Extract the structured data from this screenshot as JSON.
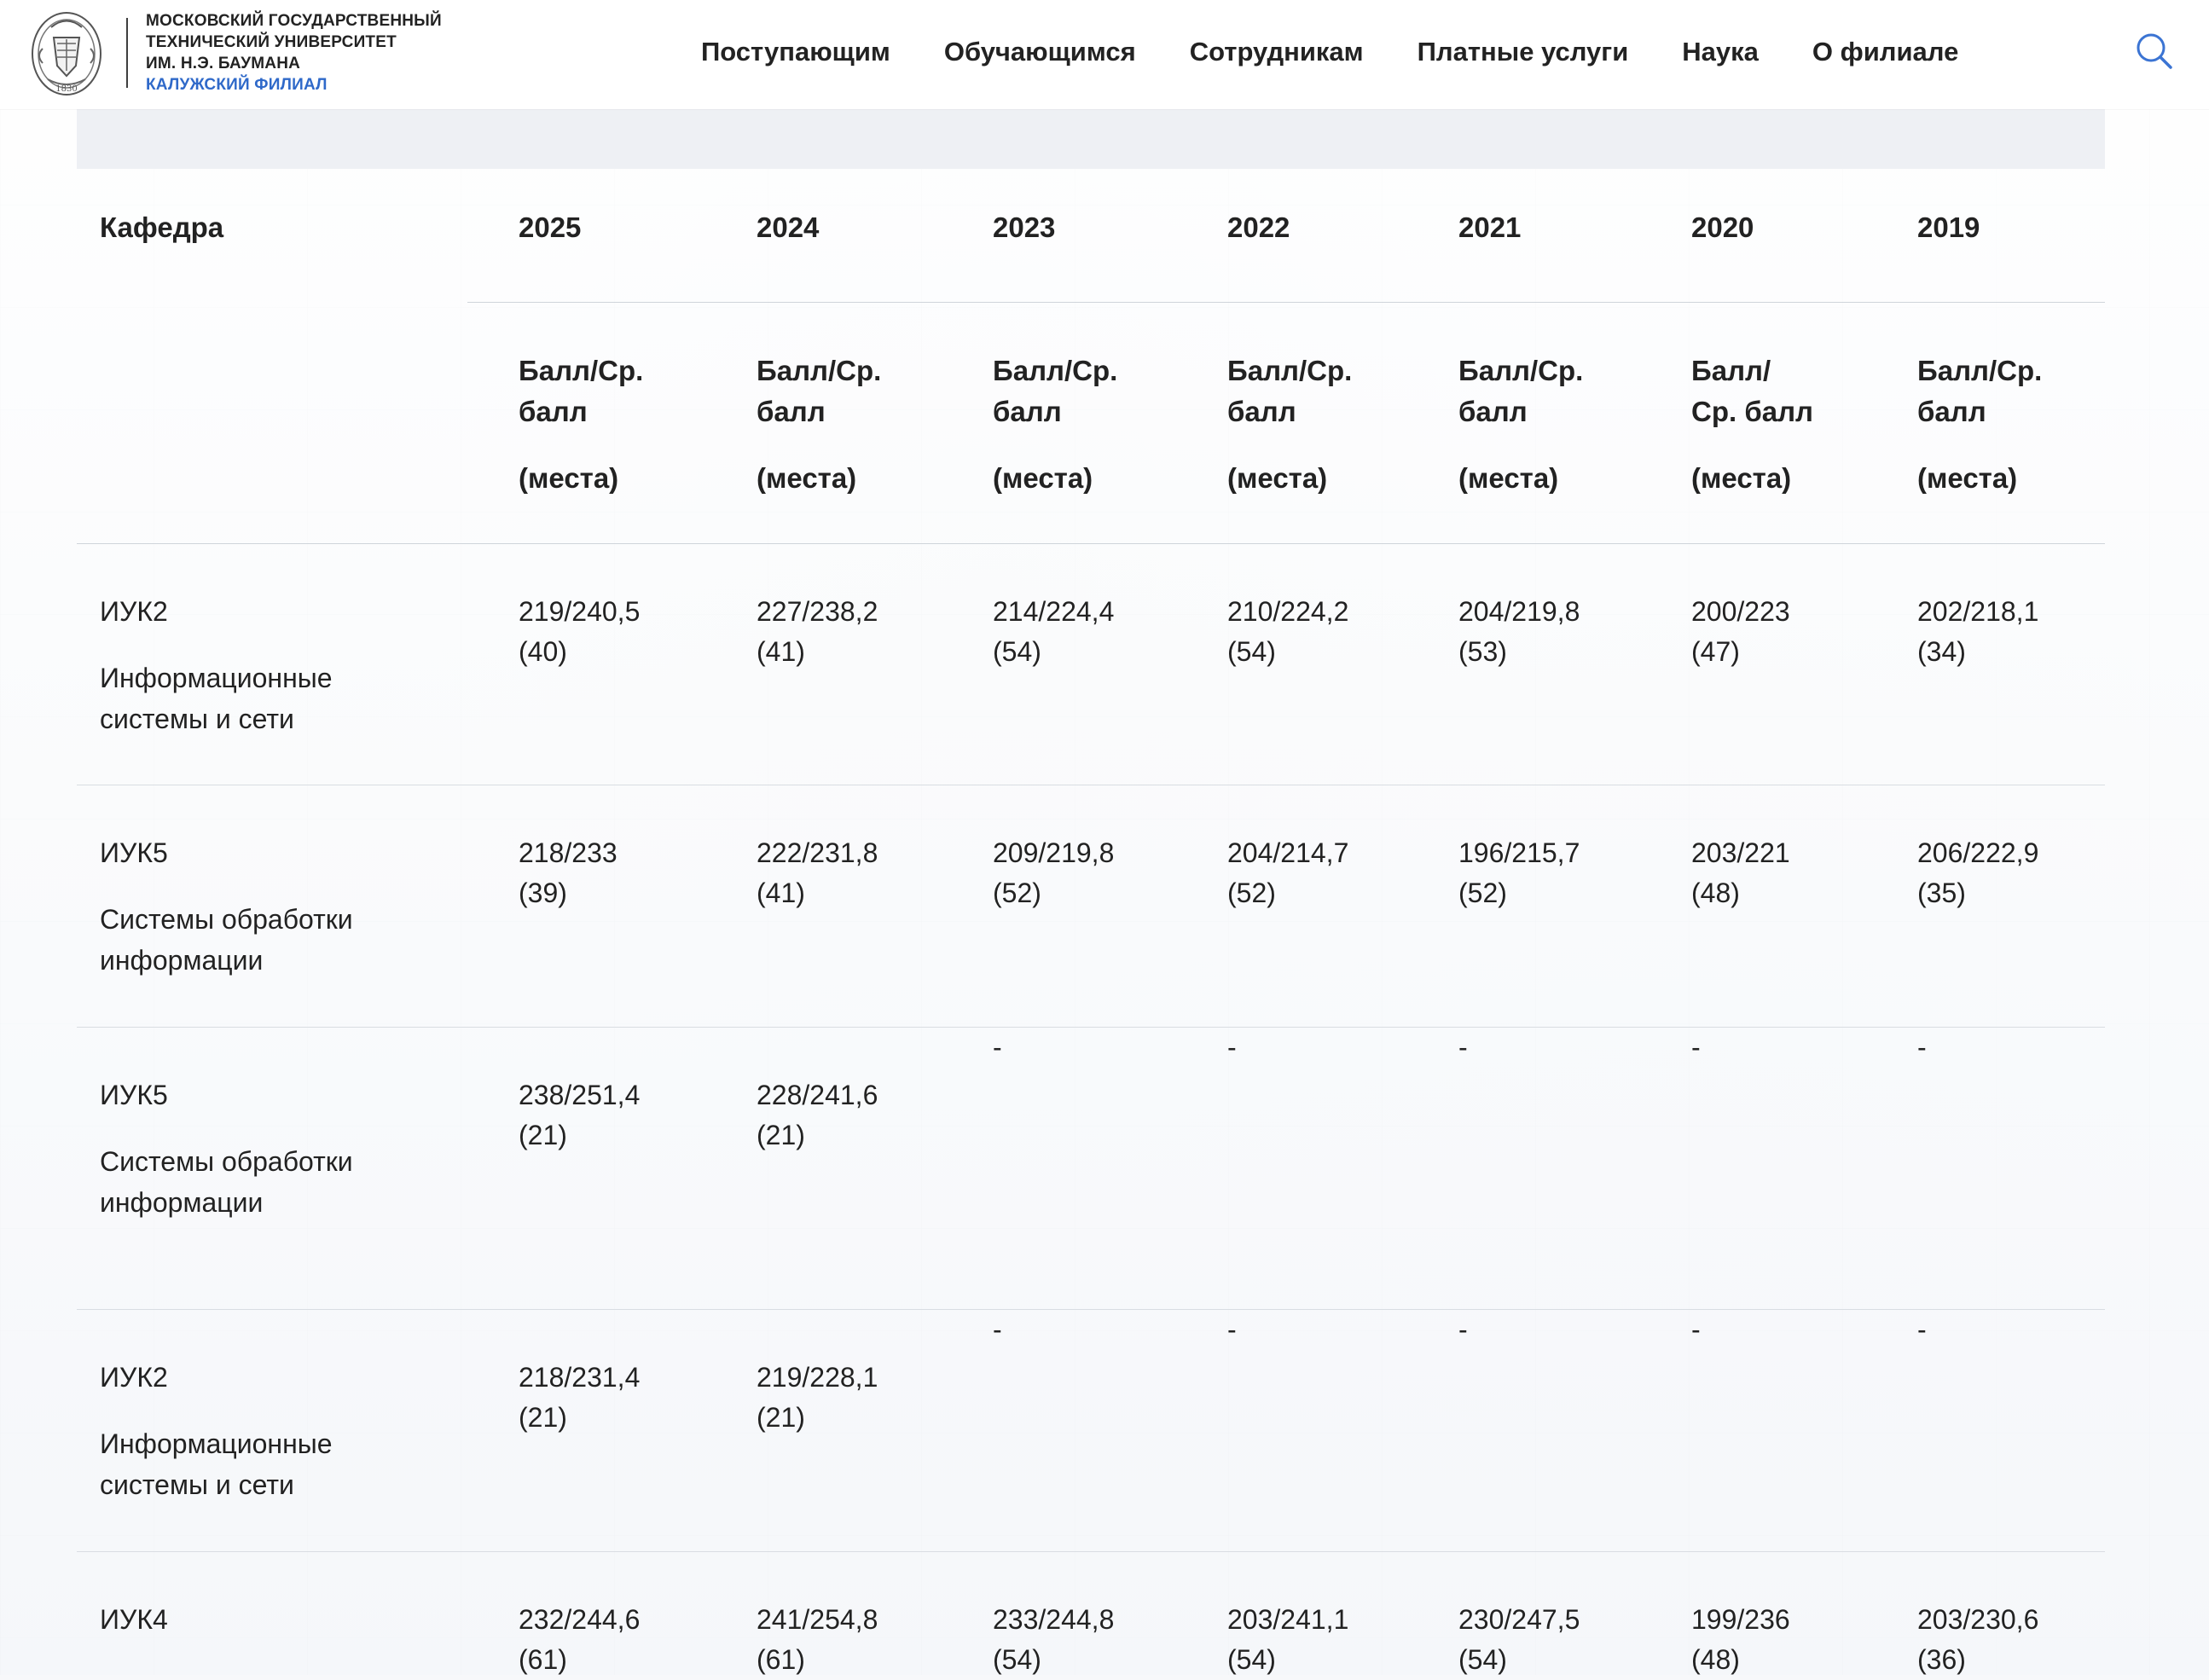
{
  "header": {
    "logo_icon": "university-crest-icon",
    "brand_lines": [
      "МОСКОВСКИЙ ГОСУДАРСТВЕННЫЙ",
      "ТЕХНИЧЕСКИЙ УНИВЕРСИТЕТ",
      "ИМ. Н.Э. БАУМАНА",
      "КАЛУЖСКИЙ ФИЛИАЛ"
    ],
    "nav": [
      "Поступающим",
      "Обучающимся",
      "Сотрудникам",
      "Платные услуги",
      "Наука",
      "О филиале"
    ],
    "search_icon": "search-icon",
    "branch_color": "#2f69c9"
  },
  "table": {
    "headers": {
      "department": "Кафедра",
      "years": [
        "2025",
        "2024",
        "2023",
        "2022",
        "2021",
        "2020",
        "2019"
      ]
    },
    "subheaders": [
      {
        "line1": "Балл/Ср.",
        "line2": "балл",
        "line3": "(места)"
      },
      {
        "line1": "Балл/Ср.",
        "line2": "балл",
        "line3": "(места)"
      },
      {
        "line1": "Балл/Ср.",
        "line2": "балл",
        "line3": "(места)"
      },
      {
        "line1": "Балл/Ср.",
        "line2": "балл",
        "line3": "(места)"
      },
      {
        "line1": "Балл/Ср.",
        "line2": "балл",
        "line3": "(места)"
      },
      {
        "line1": "Балл/",
        "line2": "Ср. балл",
        "line3": "(места)"
      },
      {
        "line1": "Балл/Ср.",
        "line2": "балл",
        "line3": "(места)"
      }
    ],
    "rows": [
      {
        "code": "ИУК2",
        "name": "Информационные системы и сети",
        "values": [
          "219/240,5\n(40)",
          "227/238,2\n(41)",
          "214/224,4\n(54)",
          "210/224,2\n(54)",
          "204/219,8\n(53)",
          "200/223\n(47)",
          "202/218,1\n(34)"
        ]
      },
      {
        "code": "ИУК5",
        "name": "Системы обработки информации",
        "values": [
          "218/233\n(39)",
          "222/231,8\n(41)",
          "209/219,8\n(52)",
          "204/214,7\n(52)",
          "196/215,7\n(52)",
          "203/221\n(48)",
          "206/222,9\n(35)"
        ]
      },
      {
        "code": "ИУК5",
        "name": "Системы обработки информации",
        "values": [
          "238/251,4\n(21)",
          "228/241,6\n(21)",
          "-",
          "-",
          "-",
          "-",
          "-"
        ]
      },
      {
        "code": "ИУК2",
        "name": "Информационные системы и сети",
        "values": [
          "218/231,4\n(21)",
          "219/228,1\n(21)",
          "-",
          "-",
          "-",
          "-",
          "-"
        ]
      },
      {
        "code": "ИУК4",
        "name": "",
        "values": [
          "232/244,6\n(61)",
          "241/254,8\n(61)",
          "233/244,8\n(54)",
          "203/241,1\n(54)",
          "230/247,5\n(54)",
          "199/236\n(48)",
          "203/230,6\n (36)"
        ]
      }
    ]
  }
}
